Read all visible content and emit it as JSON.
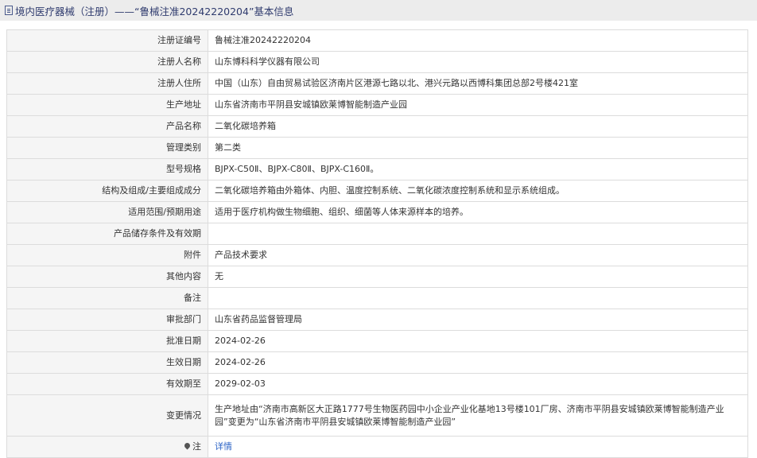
{
  "header": {
    "title": "境内医疗器械（注册）——“鲁械注准20242220204”基本信息"
  },
  "rows": [
    {
      "label": "注册证编号",
      "value": "鲁械注准20242220204"
    },
    {
      "label": "注册人名称",
      "value": "山东博科科学仪器有限公司"
    },
    {
      "label": "注册人住所",
      "value": "中国（山东）自由贸易试验区济南片区港源七路以北、港兴元路以西博科集团总部2号楼421室"
    },
    {
      "label": "生产地址",
      "value": "山东省济南市平阴县安城镇欧莱博智能制造产业园"
    },
    {
      "label": "产品名称",
      "value": "二氧化碳培养箱"
    },
    {
      "label": "管理类别",
      "value": "第二类"
    },
    {
      "label": "型号规格",
      "value": "BJPX-C50Ⅱ、BJPX-C80Ⅱ、BJPX-C160Ⅱ。"
    },
    {
      "label": "结构及组成/主要组成成分",
      "value": "二氧化碳培养箱由外箱体、内胆、温度控制系统、二氧化碳浓度控制系统和显示系统组成。"
    },
    {
      "label": "适用范围/预期用途",
      "value": "适用于医疗机构做生物细胞、组织、细菌等人体来源样本的培养。"
    },
    {
      "label": "产品储存条件及有效期",
      "value": ""
    },
    {
      "label": "附件",
      "value": "产品技术要求"
    },
    {
      "label": "其他内容",
      "value": "无"
    },
    {
      "label": "备注",
      "value": ""
    },
    {
      "label": "审批部门",
      "value": "山东省药品监督管理局"
    },
    {
      "label": "批准日期",
      "value": "2024-02-26"
    },
    {
      "label": "生效日期",
      "value": "2024-02-26"
    },
    {
      "label": "有效期至",
      "value": "2029-02-03"
    },
    {
      "label": "变更情况",
      "value": "生产地址由“济南市高新区大正路1777号生物医药园中小企业产业化基地13号楼101厂房、济南市平阴县安城镇欧莱博智能制造产业园”变更为“山东省济南市平阴县安城镇欧莱博智能制造产业园”"
    }
  ],
  "footer_row": {
    "label": "注",
    "link_text": "详情",
    "icon": "map-pin-icon"
  }
}
